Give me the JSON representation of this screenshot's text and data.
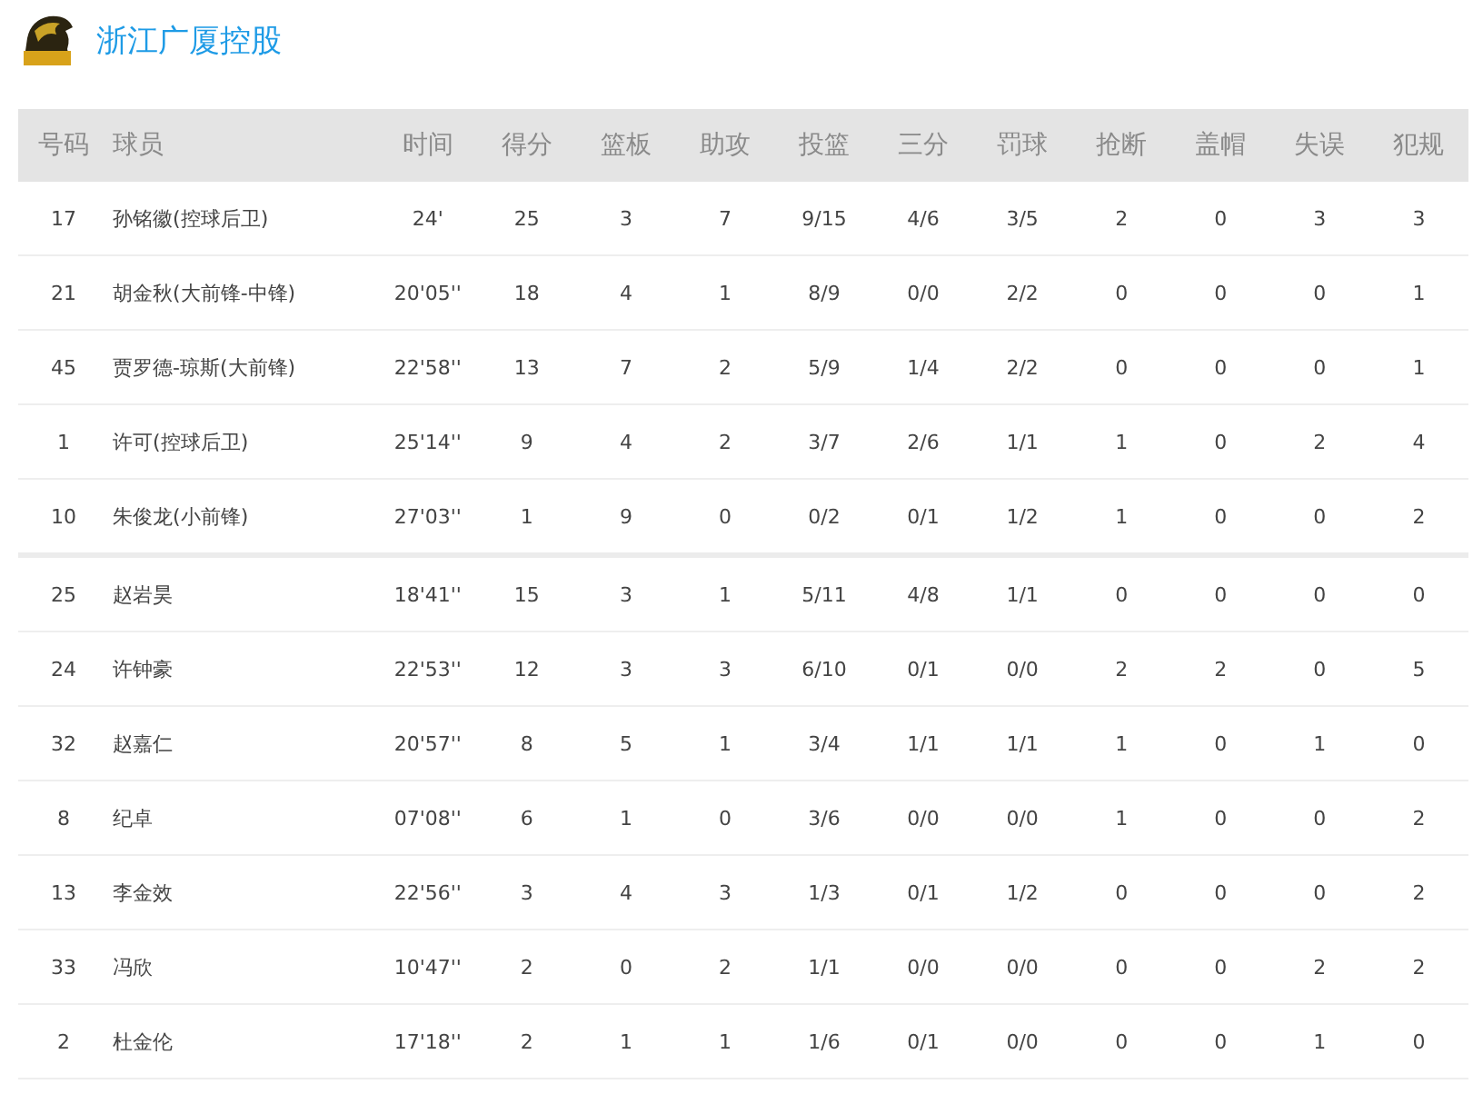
{
  "team": {
    "name": "浙江广厦控股"
  },
  "table": {
    "columns": [
      "号码",
      "球员",
      "时间",
      "得分",
      "篮板",
      "助攻",
      "投篮",
      "三分",
      "罚球",
      "抢断",
      "盖帽",
      "失误",
      "犯规"
    ],
    "starters": [
      [
        "17",
        "孙铭徽(控球后卫)",
        "24'",
        "25",
        "3",
        "7",
        "9/15",
        "4/6",
        "3/5",
        "2",
        "0",
        "3",
        "3"
      ],
      [
        "21",
        "胡金秋(大前锋-中锋)",
        "20'05''",
        "18",
        "4",
        "1",
        "8/9",
        "0/0",
        "2/2",
        "0",
        "0",
        "0",
        "1"
      ],
      [
        "45",
        "贾罗德-琼斯(大前锋)",
        "22'58''",
        "13",
        "7",
        "2",
        "5/9",
        "1/4",
        "2/2",
        "0",
        "0",
        "0",
        "1"
      ],
      [
        "1",
        "许可(控球后卫)",
        "25'14''",
        "9",
        "4",
        "2",
        "3/7",
        "2/6",
        "1/1",
        "1",
        "0",
        "2",
        "4"
      ],
      [
        "10",
        "朱俊龙(小前锋)",
        "27'03''",
        "1",
        "9",
        "0",
        "0/2",
        "0/1",
        "1/2",
        "1",
        "0",
        "0",
        "2"
      ]
    ],
    "bench": [
      [
        "25",
        "赵岩昊",
        "18'41''",
        "15",
        "3",
        "1",
        "5/11",
        "4/8",
        "1/1",
        "0",
        "0",
        "0",
        "0"
      ],
      [
        "24",
        "许钟豪",
        "22'53''",
        "12",
        "3",
        "3",
        "6/10",
        "0/1",
        "0/0",
        "2",
        "2",
        "0",
        "5"
      ],
      [
        "32",
        "赵嘉仁",
        "20'57''",
        "8",
        "5",
        "1",
        "3/4",
        "1/1",
        "1/1",
        "1",
        "0",
        "1",
        "0"
      ],
      [
        "8",
        "纪卓",
        "07'08''",
        "6",
        "1",
        "0",
        "3/6",
        "0/0",
        "0/0",
        "1",
        "0",
        "0",
        "2"
      ],
      [
        "13",
        "李金效",
        "22'56''",
        "3",
        "4",
        "3",
        "1/3",
        "0/1",
        "1/2",
        "0",
        "0",
        "0",
        "2"
      ],
      [
        "33",
        "冯欣",
        "10'47''",
        "2",
        "0",
        "2",
        "1/1",
        "0/0",
        "0/0",
        "0",
        "0",
        "2",
        "2"
      ],
      [
        "2",
        "杜金伦",
        "17'18''",
        "2",
        "1",
        "1",
        "1/6",
        "0/1",
        "0/0",
        "0",
        "0",
        "1",
        "0"
      ]
    ]
  }
}
